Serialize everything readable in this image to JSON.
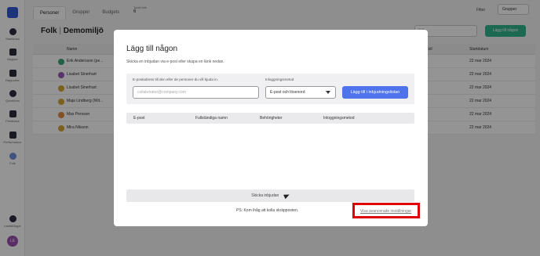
{
  "sidebar": {
    "items": [
      {
        "label": "Startsidan"
      },
      {
        "label": "Mapper"
      },
      {
        "label": "Rapporter"
      },
      {
        "label": "Questions"
      },
      {
        "label": "Feedback"
      },
      {
        "label": "Performance"
      },
      {
        "label": "Folk"
      }
    ],
    "settings_label": "Inställningar",
    "avatar_initials": "LE"
  },
  "page": {
    "tabs": [
      "Personer",
      "Grupper",
      "Budgets"
    ],
    "total_label": "Totalt folk",
    "total_value": "6",
    "filter_label": "Filter",
    "group_select": "Grupper",
    "title": "Folk",
    "title_suffix": "Demomiljö",
    "search_placeholder": "Sök",
    "add_person_label": "Lägg till någon",
    "table_headers": {
      "name": "Namn",
      "role": "Roll",
      "date": "Startdatum"
    },
    "rows": [
      {
        "name": "Erik Andersson (pe...",
        "date": "22 mar 2024",
        "avatar_color": "#3aa57a"
      },
      {
        "name": "Lisabet Sinerhart",
        "date": "22 mar 2024",
        "avatar_color": "#9a59b5"
      },
      {
        "name": "Lisabet Sinerhart",
        "date": "22 mar 2024",
        "avatar_color": "#d6a534"
      },
      {
        "name": "Maja Lindberg (Wit...",
        "date": "22 mar 2024",
        "avatar_color": "#d6a534"
      },
      {
        "name": "Max Persson",
        "date": "22 mar 2024",
        "avatar_color": "#e08a3b"
      },
      {
        "name": "Mira Nilsson",
        "date": "22 mar 2024",
        "avatar_color": "#d6a534"
      }
    ]
  },
  "modal": {
    "title": "Lägg till någon",
    "subtitle": "Skicka en inbjudan via e-post eller skapa en länk nedan.",
    "email_label": "E-postadress till den eller de personer du vill bjuda in.",
    "email_placeholder": "collaborator@company.com",
    "method_label": "Inloggningsmetod",
    "method_value": "E-post och lösenord",
    "add_button": "Lägg till i inbjudningslistan",
    "list_headers": [
      "E-post",
      "Fullständiga namn",
      "Behörigheter",
      "Inloggningsmetod"
    ],
    "send_button": "Skicka inbjudan",
    "ps_note": "PS: Kom ihåg att kolla skräpposten.",
    "advanced_link": "Visa avancerade inställningar"
  },
  "colors": {
    "primary_blue": "#4f73ea",
    "green": "#30b58c",
    "highlight_red": "#e00000"
  }
}
